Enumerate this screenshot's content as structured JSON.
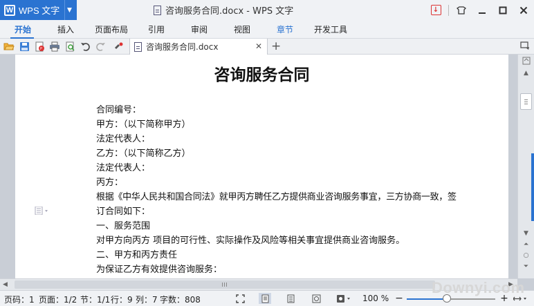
{
  "titlebar": {
    "app_logo": "W",
    "app_name": "WPS 文字",
    "window_title": "咨询服务合同.docx - WPS 文字",
    "colors": {
      "accent": "#2a73d1",
      "download": "#d33333"
    }
  },
  "ribbon": {
    "tabs": [
      {
        "label": "开始",
        "state": "active"
      },
      {
        "label": "插入"
      },
      {
        "label": "页面布局"
      },
      {
        "label": "引用"
      },
      {
        "label": "审阅"
      },
      {
        "label": "视图"
      },
      {
        "label": "章节",
        "state": "highlight"
      },
      {
        "label": "开发工具"
      }
    ]
  },
  "toolbar": {
    "icons": [
      "open-folder-icon",
      "save-icon",
      "export-pdf-icon",
      "print-icon",
      "print-preview-icon",
      "undo-icon",
      "redo-icon",
      "format-painter-icon"
    ],
    "doc_tab_label": "咨询服务合同.docx"
  },
  "document": {
    "title": "咨询服务合同",
    "lines": [
      "合同编号：",
      "甲方：（以下简称甲方）",
      "法定代表人：",
      "乙方：（以下简称乙方）",
      "法定代表人：",
      "丙方：",
      "根据《中华人民共和国合同法》就甲丙方聘任乙方提供商业咨询服务事宜，三方协商一致，签",
      "订合同如下：",
      "一、服务范围",
      "对甲方向丙方 项目的可行性、实际操作及风险等相关事宜提供商业咨询服务。",
      "二、甲方和丙方责任",
      "为保证乙方有效提供咨询服务："
    ]
  },
  "statusbar": {
    "page_num": "页码：1",
    "page_of": "页面：1/2",
    "section": "节：1/1",
    "row": "行：9",
    "col": "列：7",
    "word_count": "字数：808",
    "zoom": "100 %",
    "zoom_level_percent": 100
  },
  "watermark": "Downyi.com"
}
